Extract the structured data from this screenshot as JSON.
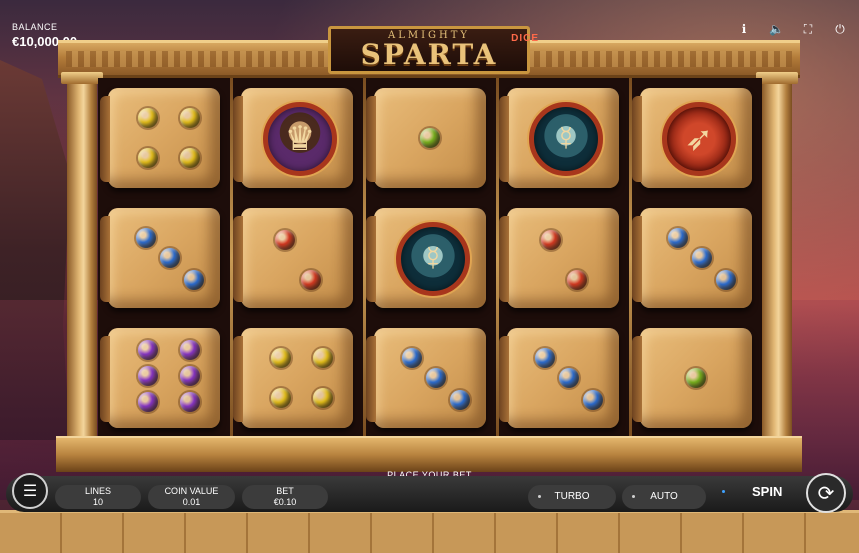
{
  "balance": {
    "label": "BALANCE",
    "value": "€10,000.00"
  },
  "top_icons": [
    "info-icon",
    "sound-icon",
    "fullscreen-icon",
    "power-icon"
  ],
  "logo": {
    "top": "ALMIGHTY",
    "main": "SPARTA",
    "tag": "DICE"
  },
  "grid": [
    [
      {
        "type": "pips",
        "count": 4,
        "color": "#e8c21a"
      },
      {
        "type": "symbol",
        "symbol": "king"
      },
      {
        "type": "pips",
        "count": 1,
        "color": "#7ab51e"
      },
      {
        "type": "symbol",
        "symbol": "medusa"
      },
      {
        "type": "symbol",
        "symbol": "spear"
      }
    ],
    [
      {
        "type": "pips",
        "count": 3,
        "color": "#2c6fd6"
      },
      {
        "type": "pips",
        "count": 2,
        "color": "#d93a22"
      },
      {
        "type": "symbol",
        "symbol": "medusa"
      },
      {
        "type": "pips",
        "count": 2,
        "color": "#d93a22"
      },
      {
        "type": "pips",
        "count": 3,
        "color": "#2c6fd6"
      }
    ],
    [
      {
        "type": "pips",
        "count": 6,
        "color": "#8a35c9"
      },
      {
        "type": "pips",
        "count": 4,
        "color": "#e8c21a"
      },
      {
        "type": "pips",
        "count": 3,
        "color": "#2c6fd6"
      },
      {
        "type": "pips",
        "count": 3,
        "color": "#2c6fd6"
      },
      {
        "type": "pips",
        "count": 1,
        "color": "#7ab51e"
      }
    ]
  ],
  "status": "PLACE YOUR BET",
  "controls": {
    "lines_label": "LINES",
    "lines_value": "10",
    "coin_label": "COIN VALUE",
    "coin_value": "0.01",
    "bet_label": "BET",
    "bet_value": "€0.10",
    "turbo": "TURBO",
    "auto": "AUTO",
    "spin": "SPIN"
  }
}
